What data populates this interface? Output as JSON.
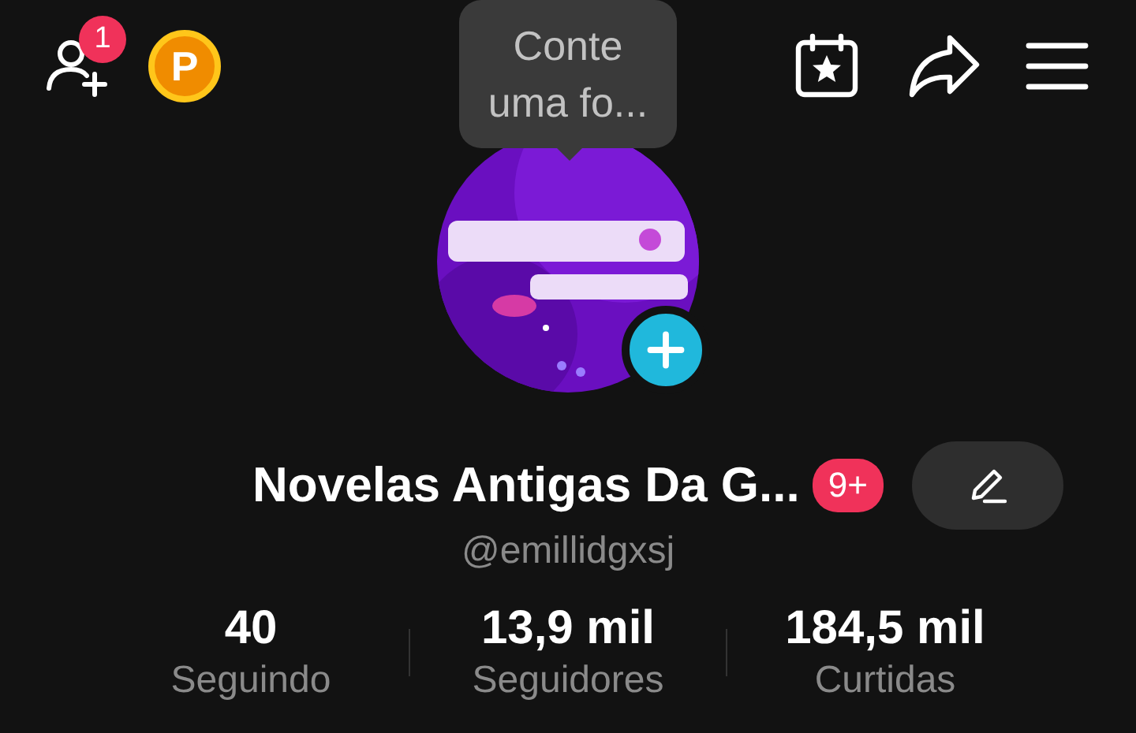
{
  "top_bar": {
    "friend_badge": "1",
    "coin_label": "P"
  },
  "tooltip": {
    "text": "Conte uma fo..."
  },
  "profile": {
    "name": "Novelas Antigas Da G...",
    "badge": "9+",
    "handle": "@emillidgxsj"
  },
  "stats": [
    {
      "value": "40",
      "label": "Seguindo"
    },
    {
      "value": "13,9 mil",
      "label": "Seguidores"
    },
    {
      "value": "184,5 mil",
      "label": "Curtidas"
    }
  ]
}
